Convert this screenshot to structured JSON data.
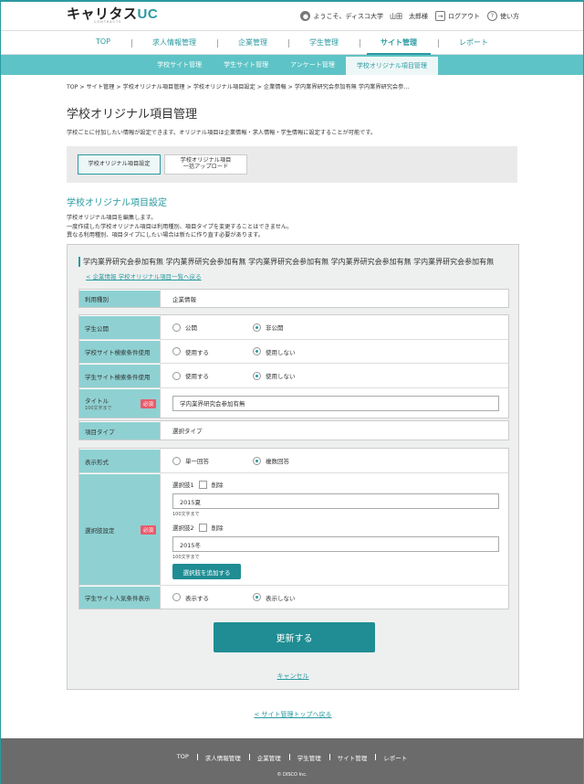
{
  "brand": {
    "logo_main": "キャリタス",
    "logo_accent": "UC",
    "logo_sub": "CONTRACTS"
  },
  "user": {
    "welcome": "ようこそ、ディスコ大学　山田　太郎様",
    "logout": "ログアウト",
    "help": "使い方"
  },
  "nav": [
    "TOP",
    "求人情報管理",
    "企業管理",
    "学生管理",
    "サイト管理",
    "レポート"
  ],
  "subnav": [
    "学校サイト管理",
    "学生サイト管理",
    "アンケート管理",
    "学校オリジナル項目管理"
  ],
  "breadcrumb": "TOP > サイト管理 > 学校オリジナル項目管理 > 学校オリジナル項目設定 > 企業情報 > 学内業界研究会参加有無 学内業界研究会参…",
  "page": {
    "title": "学校オリジナル項目管理",
    "desc": "学校ごとに付加したい情報が設定できます。オリジナル項目は企業情報・求人情報・学生情報に設定することが可能です。"
  },
  "tabs": {
    "tab1": "学校オリジナル項目設定",
    "tab2_line1": "学校オリジナル項目",
    "tab2_line2": "一括アップロード"
  },
  "section": {
    "title": "学校オリジナル項目設定",
    "desc1": "学校オリジナル項目を編集します。",
    "desc2": "一度作成した学校オリジナル項目は利用種別、項目タイプを変更することはできません。",
    "desc3": "異なる利用種別、項目タイプにしたい場合は新たに作り直す必要があります。"
  },
  "panel": {
    "title": "学内業界研究会参加有無 学内業界研究会参加有無 学内業界研究会参加有無 学内業界研究会参加有無 学内業界研究会参加有無",
    "back_link": "企業情報 学校オリジナル項目一覧へ戻る"
  },
  "form": {
    "usage_label": "利用種別",
    "usage_value": "企業情報",
    "public_label": "学生公開",
    "public_opt1": "公開",
    "public_opt2": "非公開",
    "school_search_label": "学校サイト検索条件使用",
    "school_search_opt1": "使用する",
    "school_search_opt2": "使用しない",
    "student_search_label": "学生サイト検索条件使用",
    "student_search_opt1": "使用する",
    "student_search_opt2": "使用しない",
    "title_label": "タイトル",
    "title_sub": "100文字まで",
    "required": "必須",
    "title_value": "学内業界研究会参加有無",
    "type_label": "項目タイプ",
    "type_value": "選択タイプ",
    "display_label": "表示形式",
    "display_opt1": "単一回答",
    "display_opt2": "複数回答",
    "choices_label": "選択肢設定",
    "choice1_label": "選択肢1",
    "choice1_delete": "削除",
    "choice1_value": "2015夏",
    "choice1_note": "100文字まで",
    "choice2_label": "選択肢2",
    "choice2_delete": "削除",
    "choice2_value": "2015冬",
    "choice2_note": "100文字まで",
    "add_choice": "選択肢を追加する",
    "popular_label": "学生サイト人気条件表示",
    "popular_opt1": "表示する",
    "popular_opt2": "表示しない"
  },
  "actions": {
    "update": "更新する",
    "cancel": "キャンセル",
    "back_top": "サイト管理トップへ戻る"
  },
  "footer": {
    "nav": [
      "TOP",
      "求人情報管理",
      "企業管理",
      "学生管理",
      "サイト管理",
      "レポート"
    ],
    "copyright": "© DISCO Inc."
  },
  "colors": {
    "accent": "#2a9aa0",
    "subnav_bg": "#5dc3c6",
    "label_bg": "#8fd1d2",
    "button": "#1f8d93",
    "required": "#e85c6c",
    "footer": "#6b6b6b"
  }
}
